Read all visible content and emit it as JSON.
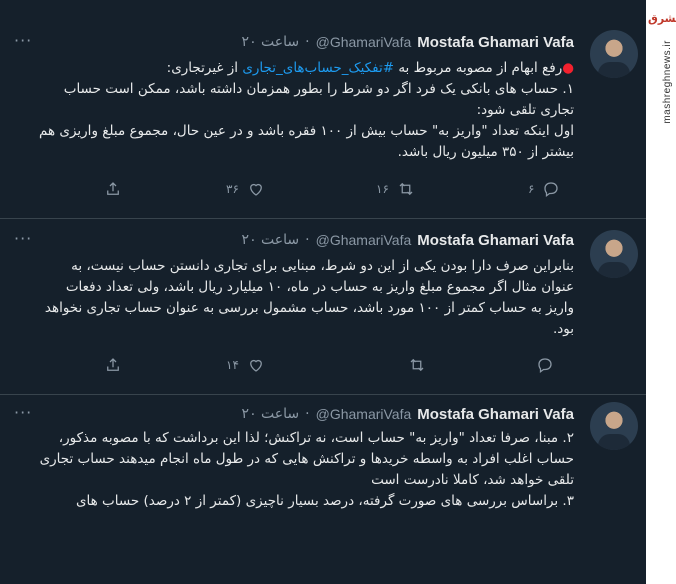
{
  "watermark": {
    "logo": "مشرق",
    "site": "mashreghnews.ir"
  },
  "tweets": [
    {
      "author": "Mostafa Ghamari Vafa",
      "handle": "@GhamariVafa",
      "time": "۲۰ ساعت",
      "dot": "·",
      "lines": [
        {
          "pre": "رفع ابهام از مصوبه مربوط به ",
          "tag": "#تفکیک_حساب‌های_تجاری",
          "post": " از غیرتجاری:",
          "red": "●"
        },
        {
          "text": "۱. حساب های بانکی یک فرد اگر دو شرط را بطور همزمان داشته باشد، ممکن است حساب تجاری تلقی شود:"
        },
        {
          "text": "اول اینکه تعداد \"واریز به\" حساب بیش از ۱۰۰ فقره باشد و در عین حال، مجموع مبلغ واریزی هم بیشتر از ۳۵۰ میلیون ریال باشد."
        }
      ],
      "stats": {
        "replies": "۶",
        "retweets": "۱۶",
        "likes": "۳۶"
      }
    },
    {
      "author": "Mostafa Ghamari Vafa",
      "handle": "@GhamariVafa",
      "time": "۲۰ ساعت",
      "dot": "·",
      "lines": [
        {
          "text": "بنابراین صرف دارا بودن یکی از این دو شرط، مبنایی برای تجاری دانستن حساب نیست، به عنوان مثال اگر مجموع مبلغ واریز به حساب در ماه، ۱۰ میلیارد ریال باشد، ولی تعداد دفعات واریز به حساب کمتر از ۱۰۰ مورد باشد، حساب  مشمول بررسی به عنوان حساب تجاری نخواهد بود."
        }
      ],
      "stats": {
        "replies": "",
        "retweets": "",
        "likes": "۱۴"
      }
    },
    {
      "author": "Mostafa Ghamari Vafa",
      "handle": "@GhamariVafa",
      "time": "۲۰ ساعت",
      "dot": "·",
      "lines": [
        {
          "text": "۲. مبنا، صرفا تعداد \"واریز به\" حساب است، نه تراکنش؛ لذا این برداشت که با مصوبه مذکور، حساب اغلب افراد به واسطه خریدها و تراکنش هایی که در طول ماه انجام میدهند حساب تجاری تلقی خواهد شد، کاملا نادرست است"
        },
        {
          "text": "۳. براساس بررسی های صورت گرفته، درصد بسیار ناچیزی (کمتر از ۲ درصد) حساب های"
        }
      ],
      "stats": null
    }
  ]
}
